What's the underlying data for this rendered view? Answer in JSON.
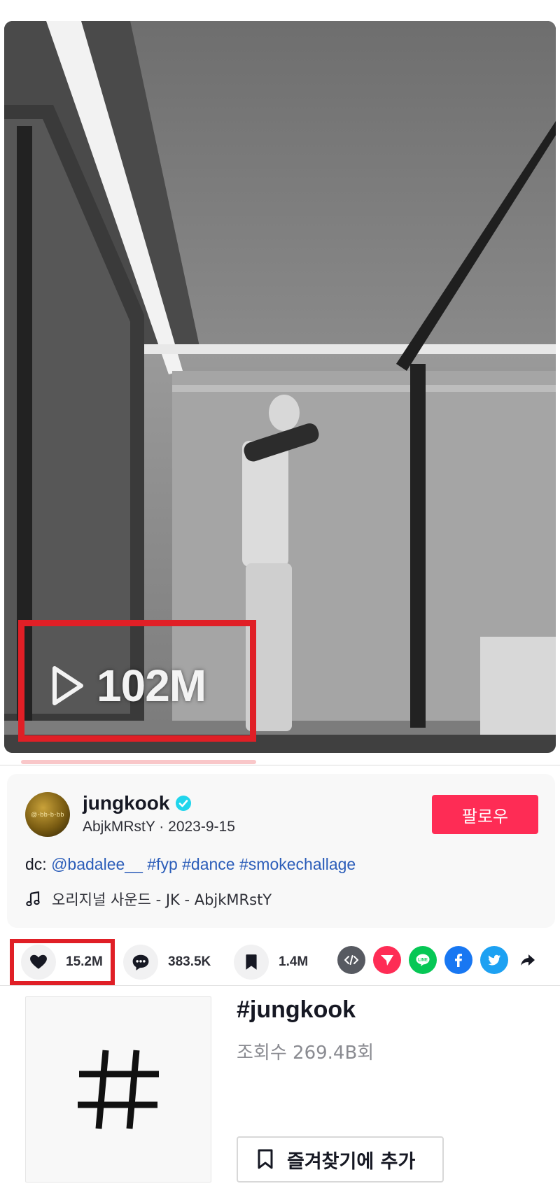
{
  "video": {
    "view_count": "102M",
    "play_icon": "play-outline-icon"
  },
  "author": {
    "username": "jungkook",
    "verified_icon": "verified-badge-icon",
    "handle_date": "AbjkMRstY · 2023-9-15",
    "follow_label": "팔로우",
    "avatar_text": "@-bb-b-bb"
  },
  "caption": {
    "prefix": "dc: ",
    "mention": "@badalee__",
    "tags": [
      "#fyp",
      "#dance",
      "#smokechallage"
    ]
  },
  "music": {
    "icon": "music-note-icon",
    "text": "오리지널 사운드 - JK - AbjkMRstY"
  },
  "actions": {
    "likes": "15.2M",
    "comments": "383.5K",
    "saves": "1.4M"
  },
  "share_targets": [
    "embed-icon",
    "send-icon",
    "line-icon",
    "facebook-icon",
    "twitter-icon",
    "share-arrow-icon"
  ],
  "hashtag": {
    "title": "#jungkook",
    "views": "조회수 269.4B회",
    "favorite_label": "즐겨찾기에 추가"
  },
  "colors": {
    "follow": "#fe2c55",
    "highlight": "#e01f26",
    "tag_link": "#2b5db9",
    "verified": "#20d5ec"
  }
}
